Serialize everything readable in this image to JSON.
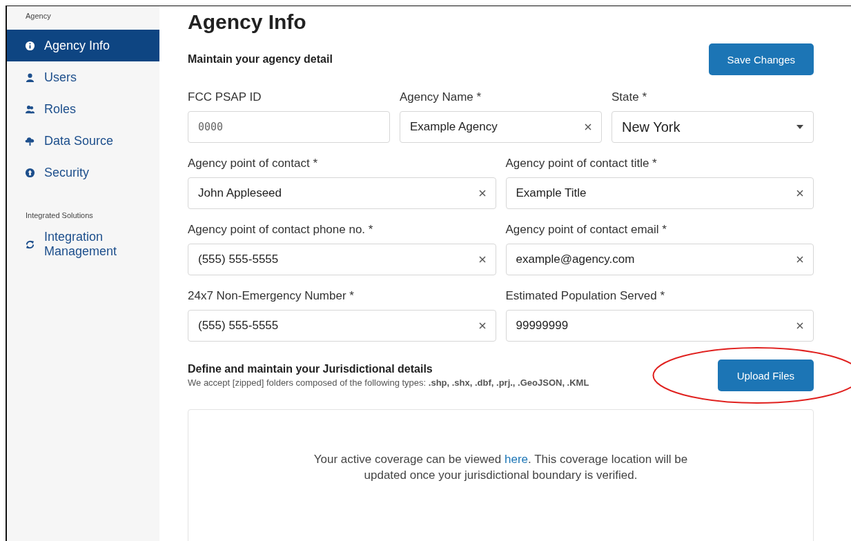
{
  "sidebar": {
    "sections": [
      {
        "heading": "Agency",
        "items": [
          {
            "label": "Agency Info",
            "selected": true
          },
          {
            "label": "Users",
            "selected": false
          },
          {
            "label": "Roles",
            "selected": false
          },
          {
            "label": "Data Source",
            "selected": false
          },
          {
            "label": "Security",
            "selected": false
          }
        ]
      },
      {
        "heading": "Integrated Solutions",
        "items": [
          {
            "label": "Integration Management",
            "selected": false
          }
        ]
      }
    ]
  },
  "page": {
    "title": "Agency Info",
    "subtitle": "Maintain your agency detail",
    "save_button": "Save Changes"
  },
  "form_rows": [
    [
      {
        "label": "FCC PSAP ID",
        "kind": "text",
        "placeholder": "0000"
      },
      {
        "label": "Agency Name *",
        "kind": "clearable",
        "value": "Example Agency"
      },
      {
        "label": "State *",
        "kind": "select",
        "value": "New York"
      }
    ],
    [
      {
        "label": "Agency point of contact *",
        "kind": "clearable",
        "value": "John Appleseed"
      },
      {
        "label": "Agency point of contact title *",
        "kind": "clearable",
        "value": "Example Title"
      }
    ],
    [
      {
        "label": "Agency point of contact phone no. *",
        "kind": "clearable",
        "value": "(555) 555-5555"
      },
      {
        "label": "Agency point of contact email *",
        "kind": "clearable",
        "value": "example@agency.com"
      }
    ],
    [
      {
        "label": "24x7 Non-Emergency Number *",
        "kind": "clearable",
        "value": "(555) 555-5555"
      },
      {
        "label": "Estimated Population Served *",
        "kind": "clearable",
        "value": "99999999"
      }
    ]
  ],
  "jurisdiction": {
    "heading": "Define and maintain your Jurisdictional details",
    "note": "We accept [zipped] folders composed of the following types: **.shp, .shx, .dbf, .prj., .GeoJSON, .KML**",
    "upload_button": "Upload Files",
    "highlighted": true
  },
  "coverage": {
    "text_before": "Your active coverage can be viewed ",
    "link": "here",
    "text_after": ". This coverage location will be updated once your jurisdictional boundary is verified."
  }
}
